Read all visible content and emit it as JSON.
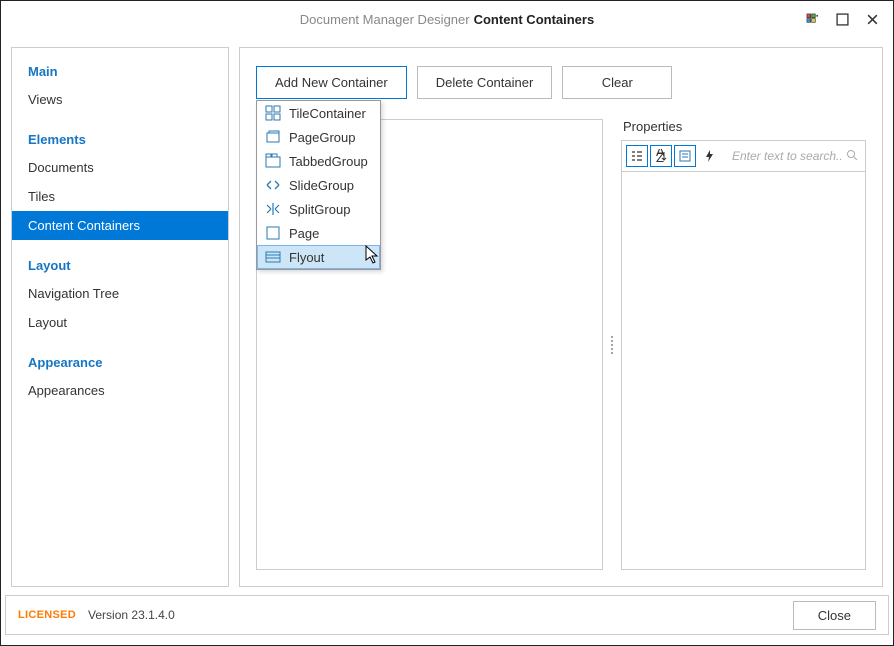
{
  "titlebar": {
    "light": "Document Manager Designer",
    "bold": "Content Containers"
  },
  "sidebar": {
    "categories": [
      {
        "label": "Main",
        "items": [
          {
            "label": "Views"
          }
        ]
      },
      {
        "label": "Elements",
        "items": [
          {
            "label": "Documents"
          },
          {
            "label": "Tiles"
          },
          {
            "label": "Content Containers",
            "active": true
          }
        ]
      },
      {
        "label": "Layout",
        "items": [
          {
            "label": "Navigation Tree"
          },
          {
            "label": "Layout"
          }
        ]
      },
      {
        "label": "Appearance",
        "items": [
          {
            "label": "Appearances"
          }
        ]
      }
    ]
  },
  "toolbar": {
    "add_label": "Add New Container",
    "delete_label": "Delete Container",
    "clear_label": "Clear"
  },
  "dropdown": {
    "items": [
      {
        "label": "TileContainer"
      },
      {
        "label": "PageGroup"
      },
      {
        "label": "TabbedGroup"
      },
      {
        "label": "SlideGroup"
      },
      {
        "label": "SplitGroup"
      },
      {
        "label": "Page"
      },
      {
        "label": "Flyout",
        "hover": true
      }
    ]
  },
  "properties": {
    "label": "Properties",
    "search_placeholder": "Enter text to search..."
  },
  "footer": {
    "licensed": "LICENSED",
    "version": "Version 23.1.4.0",
    "close": "Close"
  }
}
